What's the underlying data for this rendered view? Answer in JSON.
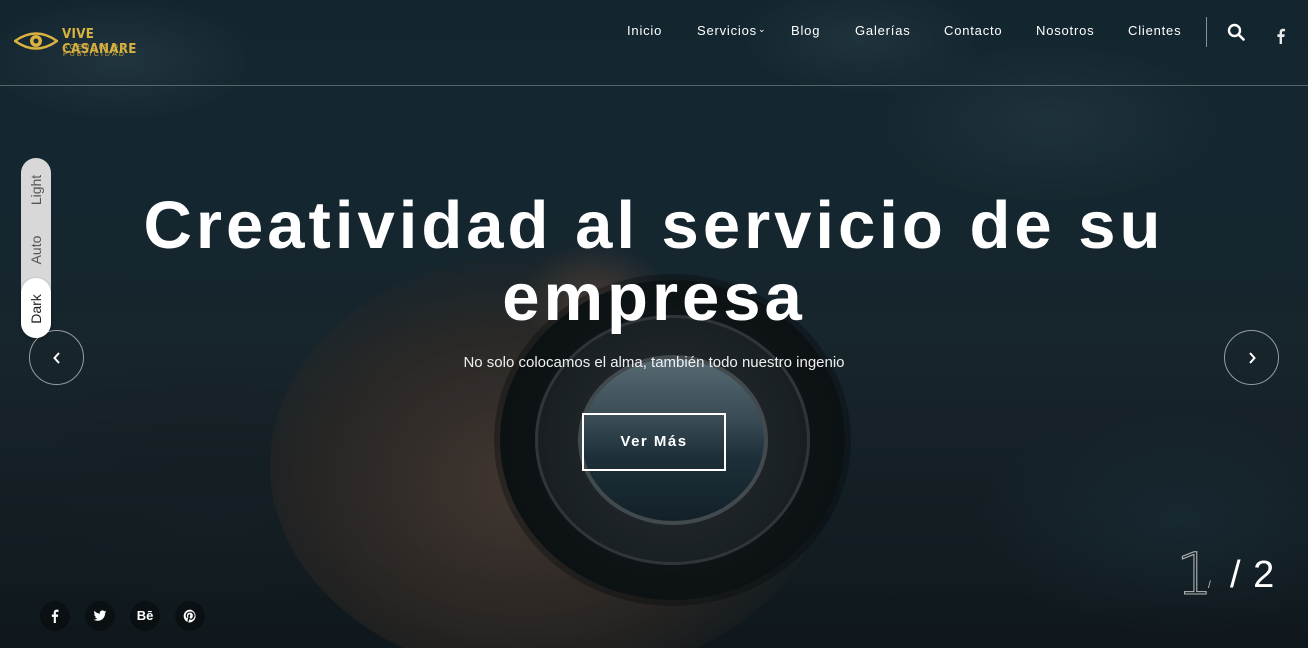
{
  "brand": {
    "name": "VIVE CASANARE",
    "tagline": "AGENCIA DE PUBLICIDAD",
    "gold": "#d9b240"
  },
  "nav": {
    "items": [
      {
        "label": "Inicio"
      },
      {
        "label": "Servicios",
        "has_dropdown": true
      },
      {
        "label": "Blog"
      },
      {
        "label": "Galerías"
      },
      {
        "label": "Contacto"
      },
      {
        "label": "Nosotros"
      },
      {
        "label": "Clientes"
      }
    ],
    "icons": [
      "search-icon",
      "facebook-icon"
    ]
  },
  "theme_switch": {
    "options": [
      "Light",
      "Auto",
      "Dark"
    ],
    "selected": "Dark"
  },
  "hero": {
    "headline_line1": "Creatividad al servicio de su",
    "headline_line2": "empresa",
    "subtitle": "No solo colocamos el alma, también todo nuestro ingenio",
    "cta_label": "Ver Más"
  },
  "slider": {
    "current": "1",
    "separator": "/",
    "total": "/ 2"
  },
  "social": [
    {
      "icon": "facebook-icon"
    },
    {
      "icon": "twitter-icon"
    },
    {
      "icon": "behance-icon",
      "label": "Bē"
    },
    {
      "icon": "pinterest-icon"
    }
  ]
}
